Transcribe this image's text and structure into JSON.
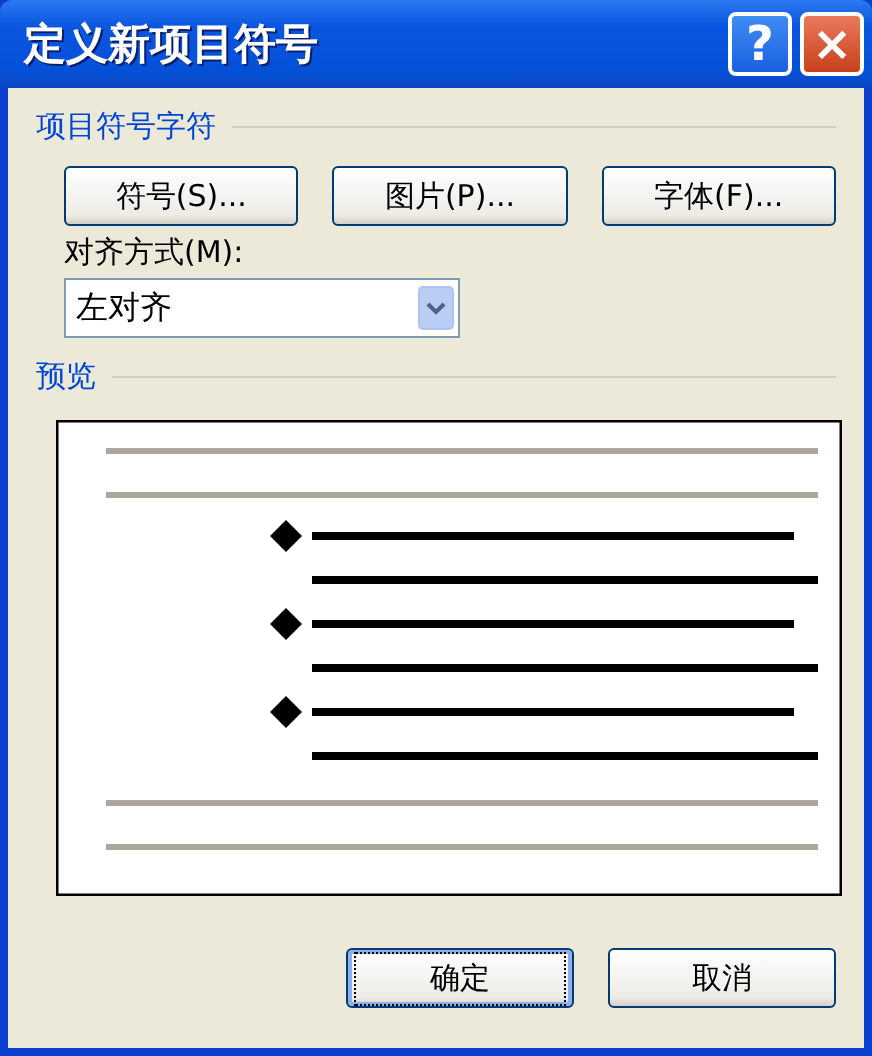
{
  "window": {
    "title": "定义新项目符号",
    "help_button": "?",
    "close_button": "×"
  },
  "bullet_character": {
    "heading": "项目符号字符",
    "buttons": [
      "符号(S)...",
      "图片(P)...",
      "字体(F)..."
    ]
  },
  "alignment": {
    "label": "对齐方式(M):",
    "value": "左对齐"
  },
  "preview": {
    "heading": "预览"
  },
  "buttons": [
    {
      "label": "确定",
      "default": true
    },
    {
      "label": "取消",
      "default": false
    }
  ]
}
